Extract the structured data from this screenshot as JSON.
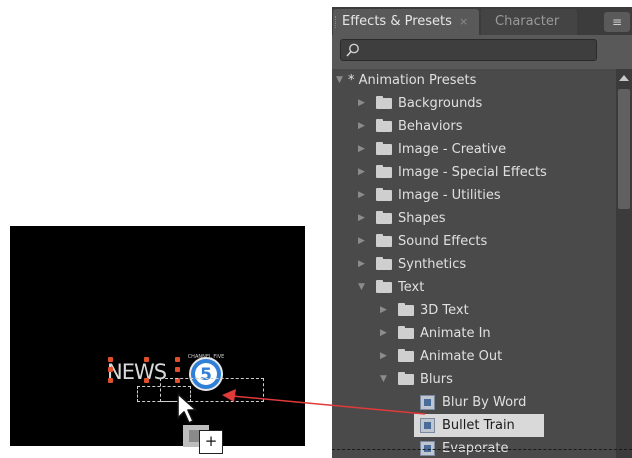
{
  "composition": {
    "news_text": "NEWS",
    "logo_digit": "5",
    "logo_ring_text": "CHANNEL FIVE"
  },
  "drag": {
    "plus_label": "+"
  },
  "panel": {
    "tabs": [
      {
        "label": "Effects & Presets",
        "close": "×",
        "active": true
      },
      {
        "label": "Character",
        "active": false
      }
    ],
    "menu_icon": "≡",
    "search": {
      "value": "",
      "placeholder": ""
    },
    "tree": [
      {
        "label": "* Animation Presets",
        "level": 0,
        "expanded": true,
        "kind": "root"
      },
      {
        "label": "Backgrounds",
        "level": 1,
        "expanded": false,
        "kind": "folder"
      },
      {
        "label": "Behaviors",
        "level": 1,
        "expanded": false,
        "kind": "folder"
      },
      {
        "label": "Image - Creative",
        "level": 1,
        "expanded": false,
        "kind": "folder"
      },
      {
        "label": "Image - Special Effects",
        "level": 1,
        "expanded": false,
        "kind": "folder"
      },
      {
        "label": "Image - Utilities",
        "level": 1,
        "expanded": false,
        "kind": "folder"
      },
      {
        "label": "Shapes",
        "level": 1,
        "expanded": false,
        "kind": "folder"
      },
      {
        "label": "Sound Effects",
        "level": 1,
        "expanded": false,
        "kind": "folder"
      },
      {
        "label": "Synthetics",
        "level": 1,
        "expanded": false,
        "kind": "folder"
      },
      {
        "label": "Text",
        "level": 1,
        "expanded": true,
        "kind": "folder"
      },
      {
        "label": "3D Text",
        "level": 2,
        "expanded": false,
        "kind": "folder"
      },
      {
        "label": "Animate In",
        "level": 2,
        "expanded": false,
        "kind": "folder"
      },
      {
        "label": "Animate Out",
        "level": 2,
        "expanded": false,
        "kind": "folder"
      },
      {
        "label": "Blurs",
        "level": 2,
        "expanded": true,
        "kind": "folder"
      },
      {
        "label": "Blur By Word",
        "level": 3,
        "kind": "preset"
      },
      {
        "label": "Bullet Train",
        "level": 3,
        "kind": "preset",
        "selected": true
      },
      {
        "label": "Evaporate",
        "level": 3,
        "kind": "preset"
      }
    ]
  },
  "colors": {
    "arrow": "#e03a3a",
    "handles": "#e0502a",
    "selected_row": "#d9d9d9"
  }
}
